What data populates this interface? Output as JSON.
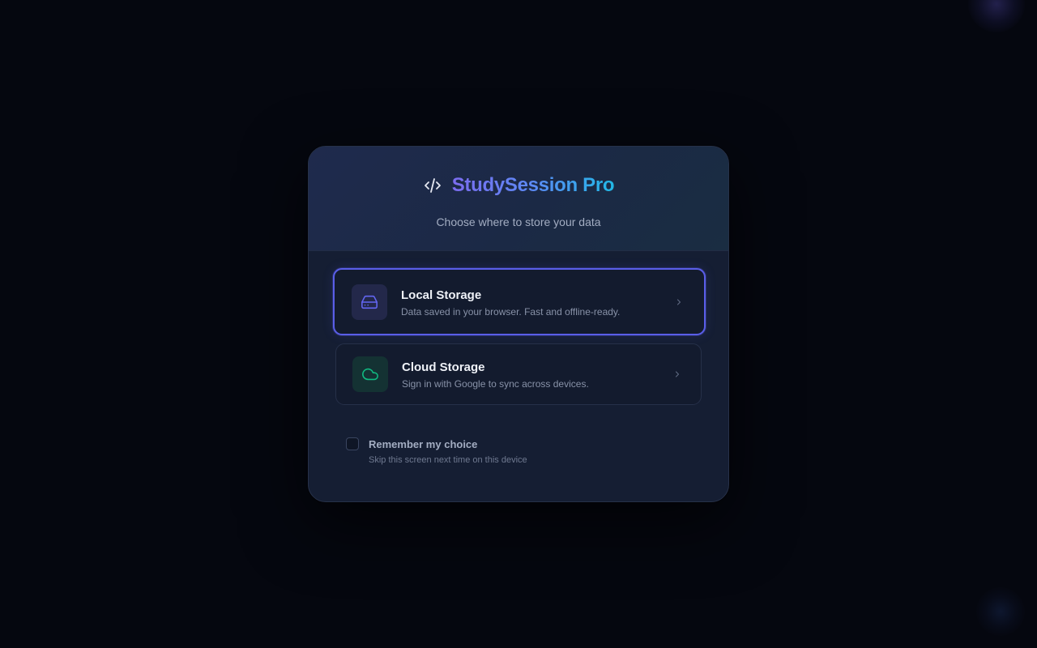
{
  "app": {
    "name": "StudySession Pro",
    "subtitle": "Choose where to store your data",
    "logo_icon": "code-brackets-icon"
  },
  "options": [
    {
      "id": "local",
      "title": "Local Storage",
      "description": "Data saved in your browser. Fast and offline-ready.",
      "icon": "hard-drive-icon",
      "icon_color": "#6366f1",
      "selected": true
    },
    {
      "id": "cloud",
      "title": "Cloud Storage",
      "description": "Sign in with Google to sync across devices.",
      "icon": "cloud-icon",
      "icon_color": "#10b981",
      "selected": false
    }
  ],
  "remember": {
    "label": "Remember my choice",
    "hint": "Skip this screen next time on this device",
    "checked": false
  },
  "colors": {
    "accent": "#5a5ee8",
    "background": "#05070f",
    "card": "#151e33"
  }
}
